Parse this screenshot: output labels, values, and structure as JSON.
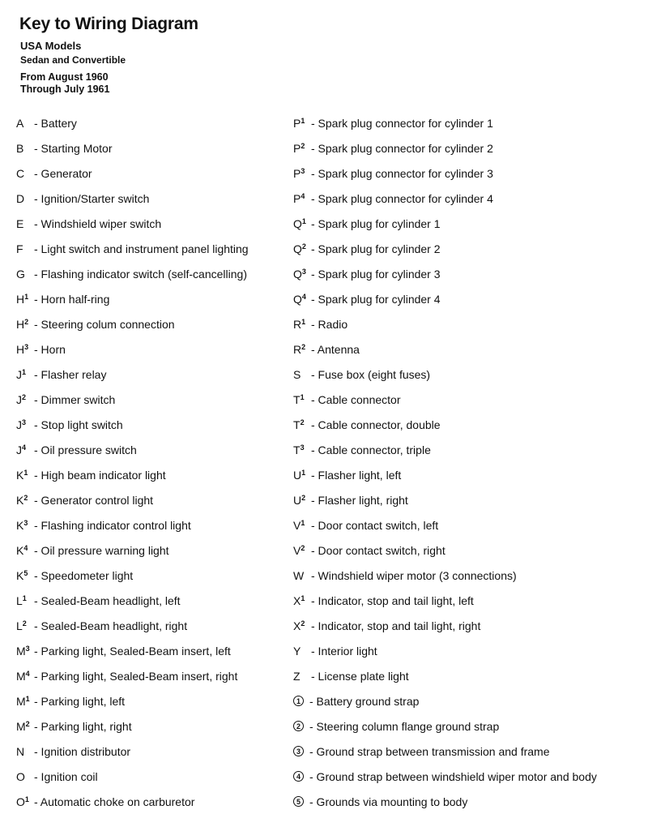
{
  "header": {
    "title": "Key to Wiring Diagram",
    "models": "USA Models",
    "body_types": "Sedan and Convertible",
    "from": "From August 1960",
    "through": "Through July 1961"
  },
  "left_column": [
    {
      "letter": "A",
      "sup": "",
      "desc": "- Battery"
    },
    {
      "letter": "B",
      "sup": "",
      "desc": "- Starting Motor"
    },
    {
      "letter": "C",
      "sup": "",
      "desc": "- Generator"
    },
    {
      "letter": "D",
      "sup": "",
      "desc": "- Ignition/Starter switch"
    },
    {
      "letter": "E",
      "sup": "",
      "desc": "- Windshield wiper switch"
    },
    {
      "letter": "F",
      "sup": "",
      "desc": "- Light switch and instrument panel lighting"
    },
    {
      "letter": "G",
      "sup": "",
      "desc": "- Flashing indicator switch (self-cancelling)"
    },
    {
      "letter": "H",
      "sup": "1",
      "desc": "- Horn half-ring"
    },
    {
      "letter": "H",
      "sup": "2",
      "desc": "- Steering colum connection"
    },
    {
      "letter": "H",
      "sup": "3",
      "desc": "- Horn"
    },
    {
      "letter": "J",
      "sup": "1",
      "desc": "- Flasher relay"
    },
    {
      "letter": "J",
      "sup": "2",
      "desc": "- Dimmer switch"
    },
    {
      "letter": "J",
      "sup": "3",
      "desc": "- Stop light switch"
    },
    {
      "letter": "J",
      "sup": "4",
      "desc": "- Oil pressure switch"
    },
    {
      "letter": "K",
      "sup": "1",
      "desc": "- High beam indicator light"
    },
    {
      "letter": "K",
      "sup": "2",
      "desc": "- Generator control light"
    },
    {
      "letter": "K",
      "sup": "3",
      "desc": "- Flashing indicator control light"
    },
    {
      "letter": "K",
      "sup": "4",
      "desc": "- Oil pressure warning light"
    },
    {
      "letter": "K",
      "sup": "5",
      "desc": "- Speedometer light"
    },
    {
      "letter": "L",
      "sup": "1",
      "desc": "- Sealed-Beam headlight, left"
    },
    {
      "letter": "L",
      "sup": "2",
      "desc": "- Sealed-Beam headlight, right"
    },
    {
      "letter": "M",
      "sup": "3",
      "desc": "- Parking light, Sealed-Beam insert, left"
    },
    {
      "letter": "M",
      "sup": "4",
      "desc": "- Parking light, Sealed-Beam insert, right"
    },
    {
      "letter": "M",
      "sup": "1",
      "desc": "- Parking light, left"
    },
    {
      "letter": "M",
      "sup": "2",
      "desc": "- Parking light, right"
    },
    {
      "letter": "N",
      "sup": "",
      "desc": "- Ignition distributor"
    },
    {
      "letter": "O",
      "sup": "",
      "desc": "- Ignition coil"
    },
    {
      "letter": "O",
      "sup": "1",
      "desc": "- Automatic choke on carburetor"
    }
  ],
  "right_column": [
    {
      "letter": "P",
      "sup": "1",
      "desc": "- Spark plug connector for cylinder 1"
    },
    {
      "letter": "P",
      "sup": "2",
      "desc": "- Spark plug connector for cylinder 2"
    },
    {
      "letter": "P",
      "sup": "3",
      "desc": "- Spark plug connector for cylinder 3"
    },
    {
      "letter": "P",
      "sup": "4",
      "desc": "- Spark plug connector for cylinder 4"
    },
    {
      "letter": "Q",
      "sup": "1",
      "desc": "- Spark plug for cylinder 1"
    },
    {
      "letter": "Q",
      "sup": "2",
      "desc": "- Spark plug for cylinder 2"
    },
    {
      "letter": "Q",
      "sup": "3",
      "desc": "- Spark plug for cylinder 3"
    },
    {
      "letter": "Q",
      "sup": "4",
      "desc": "- Spark plug for cylinder 4"
    },
    {
      "letter": "R",
      "sup": "1",
      "desc": "- Radio"
    },
    {
      "letter": "R",
      "sup": "2",
      "desc": "- Antenna"
    },
    {
      "letter": "S",
      "sup": "",
      "desc": "- Fuse box (eight fuses)"
    },
    {
      "letter": "T",
      "sup": "1",
      "desc": "- Cable connector"
    },
    {
      "letter": "T",
      "sup": "2",
      "desc": "- Cable connector, double"
    },
    {
      "letter": "T",
      "sup": "3",
      "desc": "- Cable connector, triple"
    },
    {
      "letter": "U",
      "sup": "1",
      "desc": "- Flasher light, left"
    },
    {
      "letter": "U",
      "sup": "2",
      "desc": "- Flasher light, right"
    },
    {
      "letter": "V",
      "sup": "1",
      "desc": "- Door contact switch, left"
    },
    {
      "letter": "V",
      "sup": "2",
      "desc": "- Door contact switch, right"
    },
    {
      "letter": "W",
      "sup": "",
      "desc": "- Windshield wiper motor (3 connections)"
    },
    {
      "letter": "X",
      "sup": "1",
      "desc": "- Indicator, stop and tail light, left"
    },
    {
      "letter": "X",
      "sup": "2",
      "desc": "- Indicator, stop and tail light, right"
    },
    {
      "letter": "Y",
      "sup": "",
      "desc": "- Interior light"
    },
    {
      "letter": "Z",
      "sup": "",
      "desc": "- License plate light"
    }
  ],
  "grounds": [
    {
      "num": "1",
      "desc": "- Battery ground strap"
    },
    {
      "num": "2",
      "desc": "- Steering column flange ground strap"
    },
    {
      "num": "3",
      "desc": "- Ground strap between transmission and frame"
    },
    {
      "num": "4",
      "desc": "- Ground strap between windshield wiper motor and body"
    },
    {
      "num": "5",
      "desc": "- Grounds via mounting to body"
    }
  ]
}
